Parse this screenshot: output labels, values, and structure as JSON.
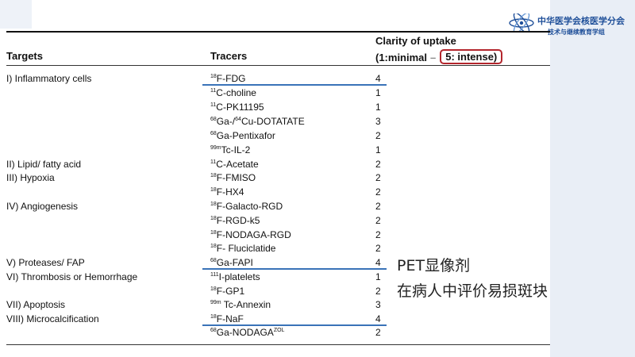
{
  "org": {
    "name": "中华医学会核医学分会",
    "sub": "技术与继续教育学组",
    "logo": "atom-logo-icon"
  },
  "header": {
    "targets": "Targets",
    "tracers": "Tracers",
    "clarity": "Clarity of uptake",
    "scale_min": "(1:minimal",
    "scale_dash": "–",
    "scale_max": "5: intense)"
  },
  "targets": [
    "I) Inflammatory cells",
    "II) Lipid/ fatty acid",
    "III) Hypoxia",
    "IV) Angiogenesis",
    "V) Proteases/ FAP",
    "VI) Thrombosis or Hemorrhage",
    "VII) Apoptosis",
    "VIII) Microcalcification"
  ],
  "rows": [
    {
      "sup": "18",
      "name": "F-FDG",
      "score": "4"
    },
    {
      "sup": "11",
      "name": "C-choline",
      "score": "1"
    },
    {
      "sup": "11",
      "name": "C-PK11195",
      "score": "1"
    },
    {
      "sup": "68",
      "name": "Ga-/",
      "sup2": "64",
      "name2": "Cu-DOTATATE",
      "score": "3"
    },
    {
      "sup": "68",
      "name": "Ga-Pentixafor",
      "score": "2"
    },
    {
      "sup": "99m",
      "name": "Tc-IL-2",
      "score": "1"
    },
    {
      "sup": "11",
      "name": "C-Acetate",
      "score": "2"
    },
    {
      "sup": "18",
      "name": "F-FMISO",
      "score": "2"
    },
    {
      "sup": "18",
      "name": "F-HX4",
      "score": "2"
    },
    {
      "sup": "18",
      "name": "F-Galacto-RGD",
      "score": "2"
    },
    {
      "sup": "18",
      "name": "F-RGD-k5",
      "score": "2"
    },
    {
      "sup": "18",
      "name": "F-NODAGA-RGD",
      "score": "2"
    },
    {
      "sup": "18",
      "name": "F- Fluciclatide",
      "score": "2"
    },
    {
      "sup": "68",
      "name": "Ga-FAPI",
      "score": "4"
    },
    {
      "sup": "111",
      "name": "I-platelets",
      "score": "1"
    },
    {
      "sup": "18",
      "name": "F-GP1",
      "score": "2"
    },
    {
      "sup": "99m",
      "name": " Tc-Annexin",
      "score": "3"
    },
    {
      "sup": "18",
      "name": "F-NaF",
      "score": "4"
    },
    {
      "sup": "68",
      "name": "Ga-NODAGA",
      "sup2": "ZOL",
      "name2": "",
      "score": "2"
    }
  ],
  "annotation": {
    "line1": "PET显像剂",
    "line2": "在病人中评价易损斑块"
  },
  "colors": {
    "highlight_box": "#b3262d",
    "rule_blue": "#3a73b8",
    "brand": "#1f4f99"
  }
}
